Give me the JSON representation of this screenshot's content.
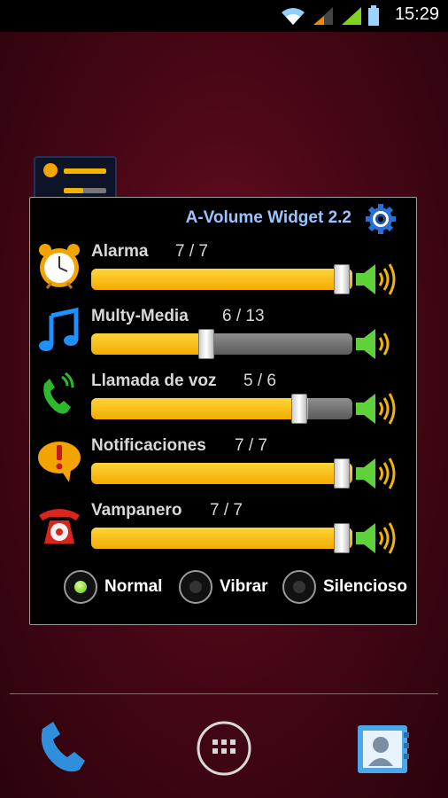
{
  "status_bar": {
    "time": "15:29",
    "icons": [
      "wifi-icon",
      "signal-weak-icon",
      "signal-full-icon",
      "battery-icon"
    ]
  },
  "widget": {
    "title": "A-Volume Widget 2.2",
    "settings_icon": "gear-icon",
    "accent_color": "#f9b800",
    "channels": [
      {
        "label": "Alarma",
        "value_text": "7 / 7",
        "level": 1.0,
        "icon": "alarm-clock-icon"
      },
      {
        "label": "Multy-Media",
        "value_text": "6 / 13",
        "level": 0.46,
        "icon": "music-note-icon"
      },
      {
        "label": "Llamada de voz",
        "value_text": "5 / 6",
        "level": 0.83,
        "icon": "phone-ringing-icon"
      },
      {
        "label": "Notificaciones",
        "value_text": "7 / 7",
        "level": 1.0,
        "icon": "notification-bubble-icon"
      },
      {
        "label": "Vampanero",
        "value_text": "7 / 7",
        "level": 1.0,
        "icon": "rotary-phone-icon"
      }
    ],
    "modes": [
      {
        "label": "Normal",
        "selected": true
      },
      {
        "label": "Vibrar",
        "selected": false
      },
      {
        "label": "Silencioso",
        "selected": false
      }
    ]
  },
  "dock": {
    "items": [
      "phone-icon",
      "app-drawer-icon",
      "contacts-icon"
    ]
  }
}
